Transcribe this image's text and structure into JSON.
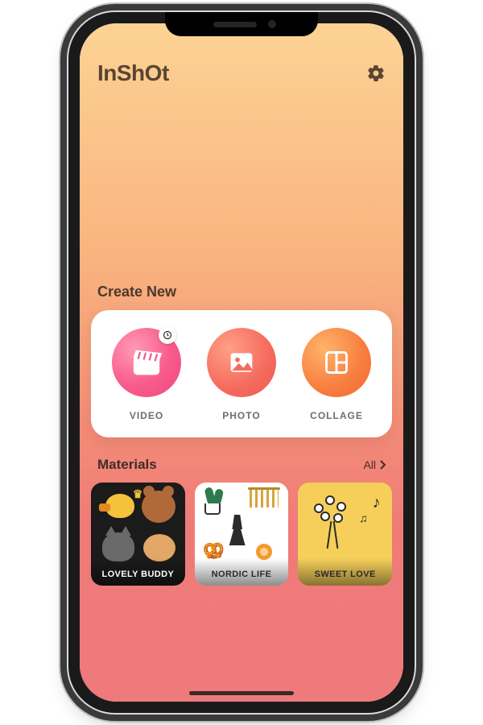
{
  "header": {
    "logo_text": "InShOt",
    "settings_icon": "gear-icon"
  },
  "create": {
    "section_label": "Create New",
    "actions": [
      {
        "label": "VIDEO",
        "icon": "clapper-icon",
        "gradient": "g-pink",
        "badge": "clock"
      },
      {
        "label": "PHOTO",
        "icon": "image-icon",
        "gradient": "g-coral"
      },
      {
        "label": "COLLAGE",
        "icon": "collage-icon",
        "gradient": "g-orange"
      }
    ]
  },
  "materials": {
    "section_label": "Materials",
    "all_label": "All",
    "items": [
      {
        "label": "LOVELY BUDDY"
      },
      {
        "label": "NORDIC LIFE"
      },
      {
        "label": "SWEET LOVE"
      }
    ]
  }
}
